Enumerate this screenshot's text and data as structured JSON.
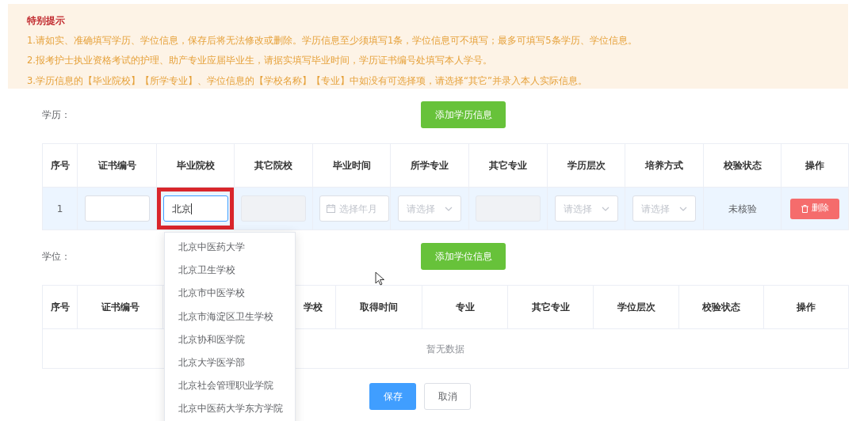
{
  "notice": {
    "title": "特别提示",
    "lines": [
      "1.请如实、准确填写学历、学位信息，保存后将无法修改或删除。学历信息至少须填写1条，学位信息可不填写；最多可填写5条学历、学位信息。",
      "2.报考护士执业资格考试的护理、助产专业应届毕业生，请据实填写毕业时间，学历证书编号处填写本人学号。",
      "3.学历信息的【毕业院校】【所学专业】、学位信息的【学校名称】【专业】中如没有可选择项，请选择“其它”并录入本人实际信息。"
    ]
  },
  "education": {
    "label": "学历：",
    "add_button": "添加学历信息",
    "columns": [
      {
        "label": "序号"
      },
      {
        "label": "证书编号"
      },
      {
        "label": "毕业院校"
      },
      {
        "label": "其它院校"
      },
      {
        "label": "毕业时间"
      },
      {
        "label": "所学专业"
      },
      {
        "label": "其它专业"
      },
      {
        "label": "学历层次"
      },
      {
        "label": "培养方式"
      },
      {
        "label": "校验状态"
      },
      {
        "label": "操作"
      }
    ],
    "rows": [
      {
        "selected": true,
        "cells": [
          {
            "kind": "text",
            "text": "1"
          },
          {
            "kind": "input",
            "disabled": false,
            "focused": false
          },
          {
            "kind": "input",
            "value": "北京",
            "disabled": false,
            "focused": true,
            "highlighted": true
          },
          {
            "kind": "input",
            "disabled": true,
            "focused": false
          },
          {
            "kind": "date",
            "placeholder": "选择年月"
          },
          {
            "kind": "select",
            "placeholder": "请选择"
          },
          {
            "kind": "input",
            "disabled": true,
            "focused": false
          },
          {
            "kind": "select",
            "placeholder": "请选择"
          },
          {
            "kind": "select",
            "placeholder": "请选择"
          },
          {
            "kind": "text",
            "text": "未核验"
          },
          {
            "kind": "button",
            "text": "删除"
          }
        ]
      }
    ]
  },
  "suggestions": [
    "北京中医药大学",
    "北京卫生学校",
    "北京市中医学校",
    "北京市海淀区卫生学校",
    "北京协和医学院",
    "北京大学医学部",
    "北京社会管理职业学院",
    "北京中医药大学东方学院"
  ],
  "degree": {
    "label": "学位：",
    "add_button": "添加学位信息",
    "columns": [
      {
        "label": "序号"
      },
      {
        "label": "证书编号"
      },
      {
        "label": "学校"
      },
      {
        "label": "取得时间"
      },
      {
        "label": "专业"
      },
      {
        "label": "其它专业"
      },
      {
        "label": "学位层次"
      },
      {
        "label": "校验状态"
      },
      {
        "label": "操作"
      }
    ],
    "empty_text": "暂无数据"
  },
  "actions": {
    "save": "保存",
    "cancel": "取消"
  }
}
